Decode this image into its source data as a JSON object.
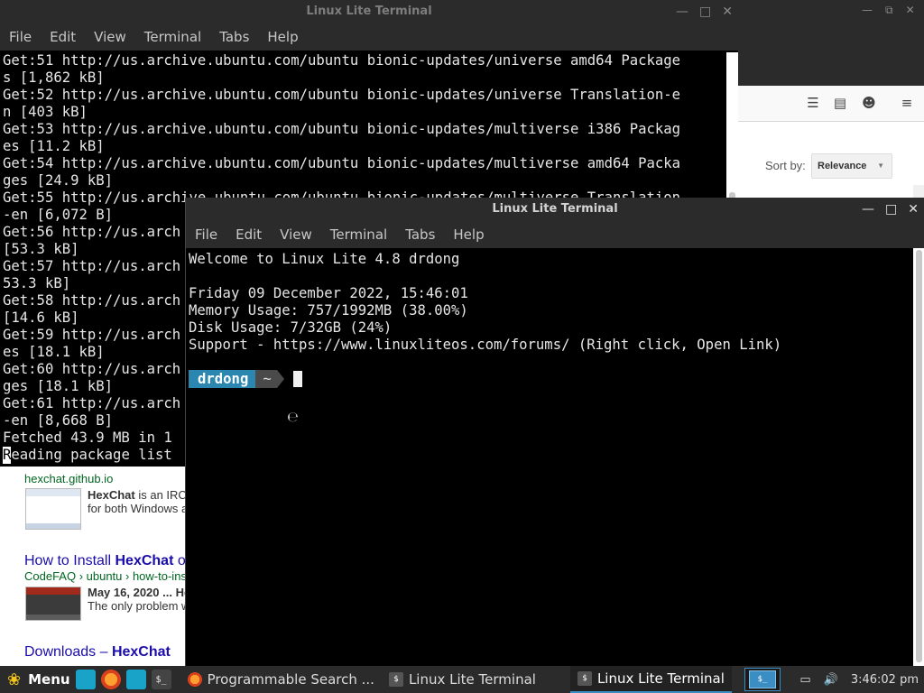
{
  "terminal_back": {
    "title": "Linux Lite Terminal",
    "menu": [
      "File",
      "Edit",
      "View",
      "Terminal",
      "Tabs",
      "Help"
    ],
    "lines": [
      "Get:51 http://us.archive.ubuntu.com/ubuntu bionic-updates/universe amd64 Package",
      "s [1,862 kB]",
      "Get:52 http://us.archive.ubuntu.com/ubuntu bionic-updates/universe Translation-e",
      "n [403 kB]",
      "Get:53 http://us.archive.ubuntu.com/ubuntu bionic-updates/multiverse i386 Packag",
      "es [11.2 kB]",
      "Get:54 http://us.archive.ubuntu.com/ubuntu bionic-updates/multiverse amd64 Packa",
      "ges [24.9 kB]",
      "Get:55 http://us.archive.ubuntu.com/ubuntu bionic-updates/multiverse Translation",
      "-en [6,072 B]",
      "Get:56 http://us.arch",
      "[53.3 kB]",
      "Get:57 http://us.arch",
      "53.3 kB]",
      "Get:58 http://us.arch",
      "[14.6 kB]",
      "Get:59 http://us.arch",
      "es [18.1 kB]",
      "Get:60 http://us.arch",
      "ges [18.1 kB]",
      "Get:61 http://us.arch",
      "-en [8,668 B]",
      "Fetched 43.9 MB in 1",
      "Reading package list"
    ]
  },
  "terminal_front": {
    "title": "Linux Lite Terminal",
    "menu": [
      "File",
      "Edit",
      "View",
      "Terminal",
      "Tabs",
      "Help"
    ],
    "welcome": "Welcome to Linux Lite 4.8 drdong",
    "date": "Friday 09 December 2022, 15:46:01",
    "memory": "Memory Usage: 757/1992MB (38.00%)",
    "disk": "Disk Usage: 7/32GB (24%)",
    "support": "Support - https://www.linuxliteos.com/forums/ (Right click, Open Link)",
    "prompt_user": "drdong",
    "prompt_dir": "~"
  },
  "browser": {
    "sort_label": "Sort by:",
    "sort_value": "Relevance",
    "results": [
      {
        "url": "hexchat.github.io",
        "snippet_1_bold": "HexChat",
        "snippet_1": " is an IRC",
        "snippet_2": "for both Windows a"
      },
      {
        "title_prefix": "How to Install ",
        "title_bold": "HexChat",
        "title_suffix": " o",
        "url": "CodeFAQ › ubuntu › how-to-ins",
        "snippet_1_bold": "May 16, 2020 ... He",
        "snippet_1": "",
        "snippet_2": "The only problem w"
      },
      {
        "title_prefix": "Downloads – ",
        "title_bold": "HexChat",
        "title_suffix": ""
      }
    ]
  },
  "taskbar": {
    "menu_label": "Menu",
    "tasks": [
      "Programmable Search ...",
      "Linux Lite Terminal",
      "Linux Lite Terminal"
    ],
    "clock": "3:46:02 pm"
  }
}
